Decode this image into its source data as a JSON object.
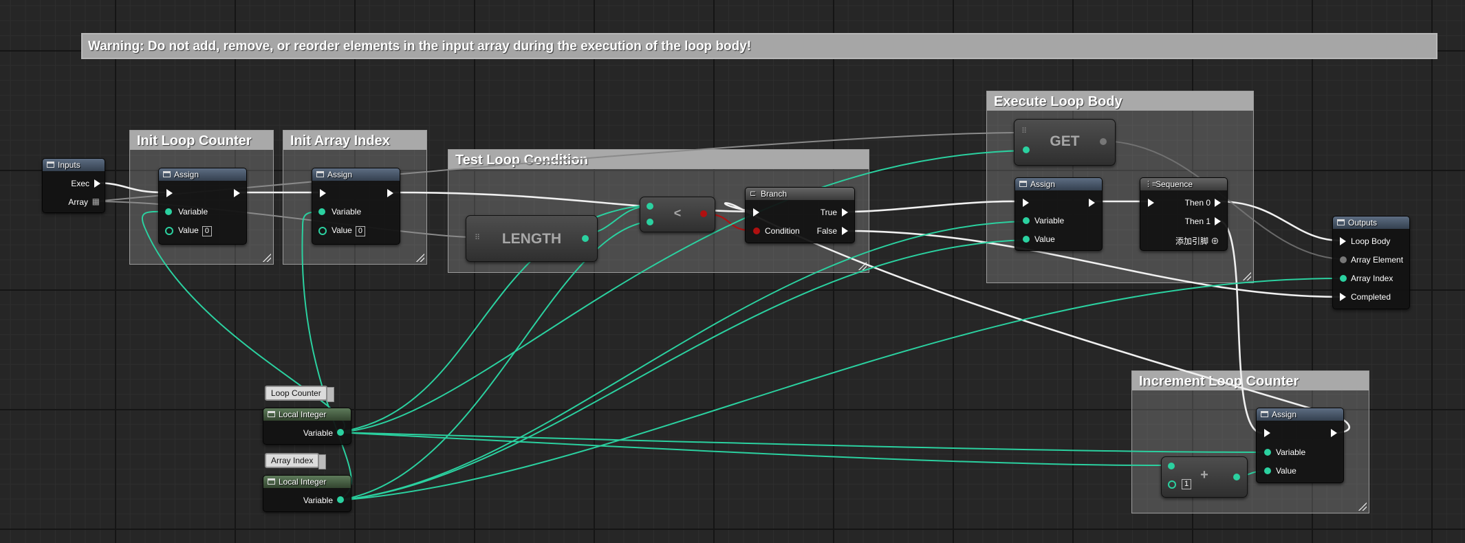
{
  "warning": "Warning: Do not add, remove, or reorder elements in the input array during the execution of the loop body!",
  "comments": {
    "init_loop_counter": "Init Loop Counter",
    "init_array_index": "Init Array Index",
    "test_loop_condition": "Test Loop Condition",
    "execute_loop_body": "Execute Loop Body",
    "increment_loop_counter": "Increment Loop Counter"
  },
  "inputs_node": {
    "title": "Inputs",
    "pins": [
      "Exec",
      "Array"
    ]
  },
  "assign_1": {
    "title": "Assign",
    "variable": "Variable",
    "value": "Value",
    "value_default": "0"
  },
  "assign_2": {
    "title": "Assign",
    "variable": "Variable",
    "value": "Value",
    "value_default": "0"
  },
  "length_node": {
    "label": "LENGTH"
  },
  "less_node": {
    "label": "<"
  },
  "branch_node": {
    "title": "Branch",
    "true_label": "True",
    "false_label": "False",
    "condition": "Condition"
  },
  "get_node": {
    "label": "GET"
  },
  "assign_3": {
    "title": "Assign",
    "variable": "Variable",
    "value": "Value"
  },
  "sequence_node": {
    "title": "Sequence",
    "then0": "Then 0",
    "then1": "Then 1",
    "add_pin": "添加引脚"
  },
  "outputs_node": {
    "title": "Outputs",
    "pins": [
      "Loop Body",
      "Array Element",
      "Array Index",
      "Completed"
    ]
  },
  "assign_4": {
    "title": "Assign",
    "variable": "Variable",
    "value": "Value"
  },
  "add_node": {
    "label": "+",
    "default_value": "1"
  },
  "local_loop_counter": {
    "tag": "Loop Counter",
    "title": "Local Integer",
    "pin": "Variable"
  },
  "local_array_index": {
    "tag": "Array Index",
    "title": "Local Integer",
    "pin": "Variable"
  },
  "colors": {
    "exec": "#f0f0f0",
    "integer": "#2bd1a0",
    "boolean": "#b01010",
    "comment": "#a9a9a9"
  }
}
